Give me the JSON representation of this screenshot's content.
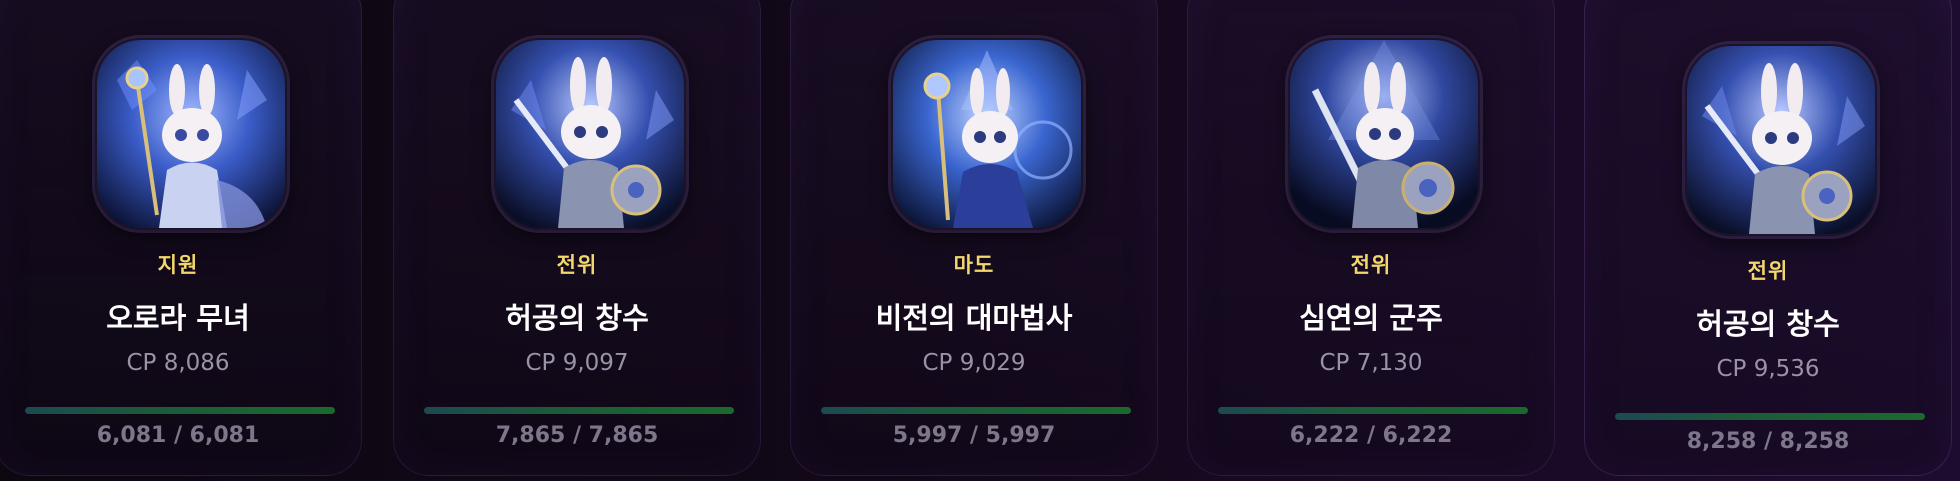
{
  "cards": [
    {
      "role": "지원",
      "name": "오로라 무녀",
      "cp": "CP 8,086",
      "hp_text": "6,081 / 6,081",
      "hp_fraction": 1.0,
      "portrait": "rabbit-mage-icon",
      "accent": "#3a5cc8"
    },
    {
      "role": "전위",
      "name": "허공의 창수",
      "cp": "CP 9,097",
      "hp_text": "7,865 / 7,865",
      "hp_fraction": 1.0,
      "portrait": "rabbit-knight-icon",
      "accent": "#3550b0"
    },
    {
      "role": "마도",
      "name": "비전의 대마법사",
      "cp": "CP 9,029",
      "hp_text": "5,997 / 5,997",
      "hp_fraction": 1.0,
      "portrait": "rabbit-archmage-icon",
      "accent": "#3a66d0"
    },
    {
      "role": "전위",
      "name": "심연의 군주",
      "cp": "CP 7,130",
      "hp_text": "6,222 / 6,222",
      "hp_fraction": 1.0,
      "portrait": "rabbit-knight-icon",
      "accent": "#3048a0"
    },
    {
      "role": "전위",
      "name": "허공의 창수",
      "cp": "CP 9,536",
      "hp_text": "8,258 / 8,258",
      "hp_fraction": 1.0,
      "portrait": "rabbit-knight-icon",
      "accent": "#3550b0"
    }
  ],
  "colors": {
    "role": "#f2d86a",
    "name": "#ffffff",
    "cp": "#9a92a6",
    "hp_text": "#7e768a",
    "hp_bar": "#1a6a2c"
  }
}
